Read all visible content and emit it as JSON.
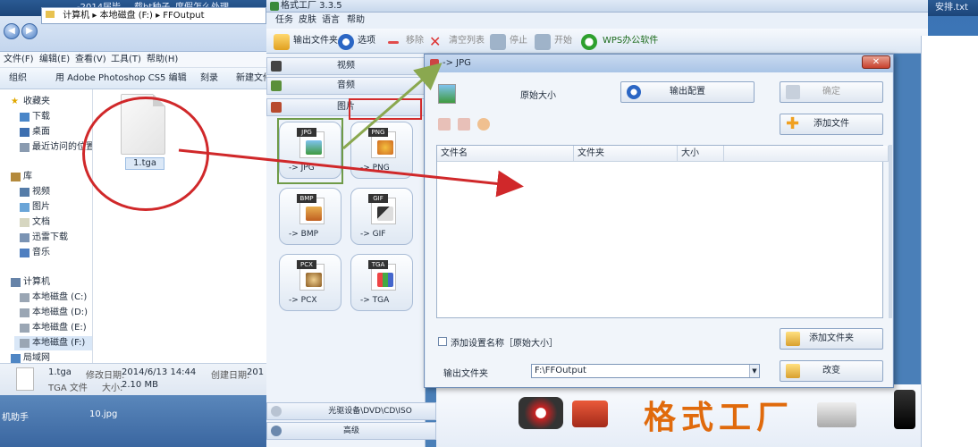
{
  "taskbar": {
    "left_text": "-2014届毕...",
    "item2": "载bt种子",
    "item3": "度假怎么处理",
    "right_text": "安排.txt"
  },
  "explorer": {
    "address": [
      "计算机",
      "本地磁盘 (F:)",
      "FFOutput"
    ],
    "menu": [
      "文件(F)",
      "编辑(E)",
      "查看(V)",
      "工具(T)",
      "帮助(H)"
    ],
    "toolbar": [
      "组织",
      "用 Adobe Photoshop CS5 编辑",
      "刻录",
      "新建文件夹"
    ],
    "nav": {
      "favorites": "收藏夹",
      "fav_items": [
        "下载",
        "桌面",
        "最近访问的位置"
      ],
      "library": "库",
      "lib_items": [
        "视频",
        "图片",
        "文档",
        "迅雷下载",
        "音乐"
      ],
      "computer": "计算机",
      "drives": [
        "本地磁盘 (C:)",
        "本地磁盘 (D:)",
        "本地磁盘 (E:)",
        "本地磁盘 (F:)"
      ],
      "network": "局域网"
    },
    "file_name": "1.tga",
    "status": {
      "name": "1.tga",
      "modified_label": "修改日期:",
      "modified_value": "2014/6/13 14:44",
      "created_label": "创建日期:",
      "created_value": "201",
      "type": "TGA 文件",
      "size_label": "大小:",
      "size_value": "2.10 MB"
    },
    "bottom_left": "机助手",
    "bottom_file": "10.jpg"
  },
  "ff": {
    "title": "格式工厂 3.3.5",
    "menu": [
      "任务",
      "皮肤",
      "语言",
      "帮助"
    ],
    "toolbar": {
      "output_folder": "输出文件夹",
      "options": "选项",
      "remove": "移除",
      "clear": "清空列表",
      "stop": "停止",
      "start": "开始",
      "wps": "WPS办公软件"
    },
    "categories": {
      "video": "视频",
      "audio": "音频",
      "image": "图片"
    },
    "formats": [
      "-> JPG",
      "-> PNG",
      "-> BMP",
      "-> GIF",
      "-> PCX",
      "-> TGA"
    ],
    "format_tags": [
      "JPG",
      "PNG",
      "BMP",
      "GIF",
      "PCX",
      "TGA"
    ],
    "bottom_cats": [
      "光驱设备\\DVD\\CD\\ISO",
      "高级"
    ],
    "brand": "格式工厂"
  },
  "dialog": {
    "title": "-> JPG",
    "original_size": "原始大小",
    "output_config": "输出配置",
    "confirm": "确定",
    "add_file": "添加文件",
    "columns": [
      "文件名",
      "文件夹",
      "大小"
    ],
    "add_setting_name": "添加设置名称［原始大小］",
    "add_folder": "添加文件夹",
    "output_folder_label": "输出文件夹",
    "output_folder_value": "F:\\FFOutput",
    "change": "改变"
  },
  "colors": {
    "annotation_red": "#d0282a",
    "annotation_green": "#6f9b48",
    "brand_orange": "#e06a0c"
  }
}
